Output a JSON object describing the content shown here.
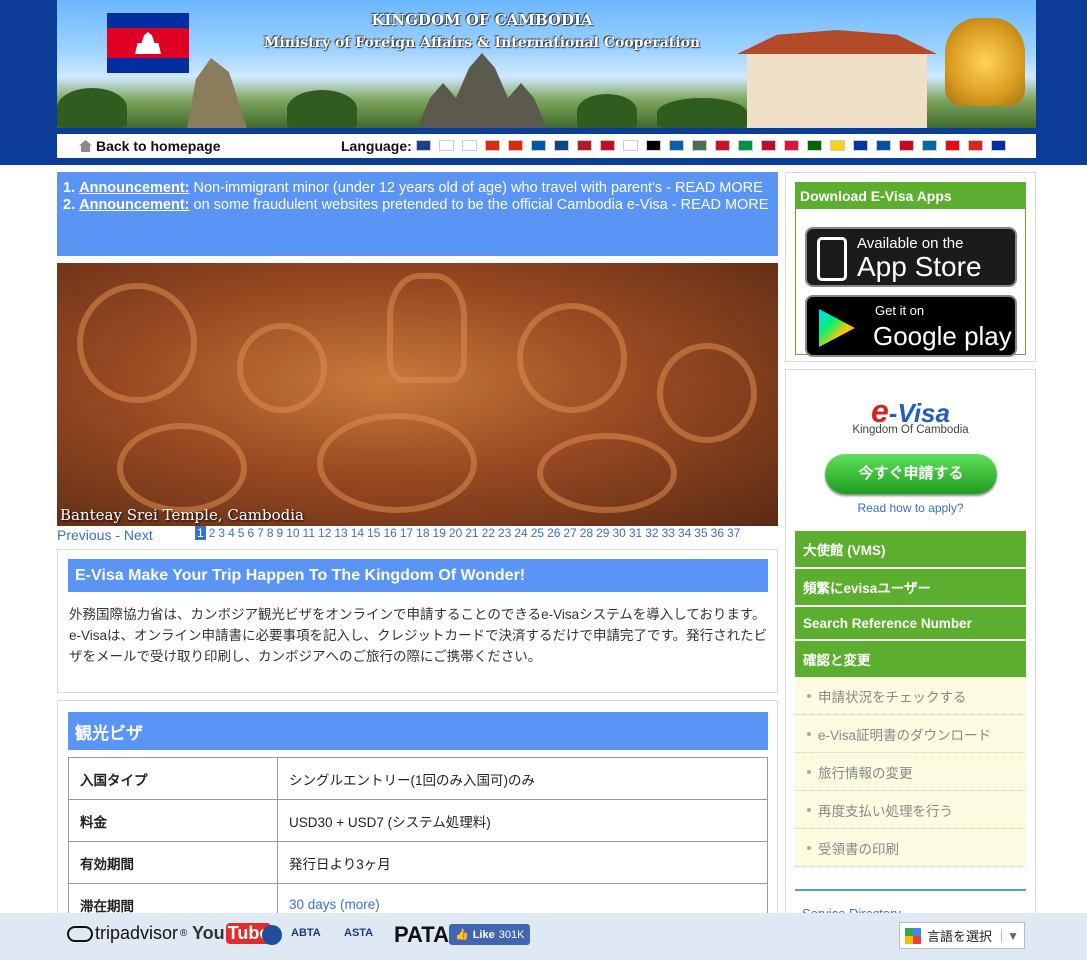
{
  "header": {
    "title_line1": "KINGDOM OF CAMBODIA",
    "title_line2": "Ministry of Foreign Affairs & International Cooperation"
  },
  "nav": {
    "home_label": "Back to homepage",
    "language_label": "Language:",
    "flag_colors": [
      "#1f3f8f",
      "#ffffff",
      "#ffffff",
      "#de2910",
      "#de2910",
      "#0055a4",
      "#11457e",
      "#ae1c28",
      "#c60b1e",
      "#ffffff",
      "#000000",
      "#0d5eaf",
      "#477050",
      "#ce1126",
      "#009246",
      "#ba0c2f",
      "#dc143c",
      "#006600",
      "#fcd116",
      "#0039a6",
      "#0b4ea2",
      "#c60b1e",
      "#006aa7",
      "#e30a17",
      "#da251d",
      "#032ea1"
    ]
  },
  "announcements": [
    {
      "num": "1.",
      "label": "Announcement:",
      "text": "Non-immigrant minor (under 12 years old of age) who travel with parent's - READ MORE"
    },
    {
      "num": "2.",
      "label": "Announcement:",
      "text": "on some fraudulent websites pretended to be the official Cambodia e-Visa - READ MORE"
    }
  ],
  "slideshow": {
    "caption": "Banteay Srei Temple, Cambodia",
    "prev": "Previous",
    "separator": " - ",
    "next": "Next",
    "current_page": "1",
    "pages": [
      "2",
      "3",
      "4",
      "5",
      "6",
      "7",
      "8",
      "9",
      "10",
      "11",
      "12",
      "13",
      "14",
      "15",
      "16",
      "17",
      "18",
      "19",
      "20",
      "21",
      "22",
      "23",
      "24",
      "25",
      "26",
      "27",
      "28",
      "29",
      "30",
      "31",
      "32",
      "33",
      "34",
      "35",
      "36",
      "37"
    ]
  },
  "intro": {
    "heading": "E-Visa Make Your Trip Happen To The Kingdom Of Wonder!",
    "body": "外務国際協力省は、カンボジア観光ビザをオンラインで申請することのできるe-Visaシステムを導入しております。e-Visaは、オンライン申請書に必要事項を記入し、クレジットカードで決済するだけで申請完了です。発行されたビザをメールで受け取り印刷し、カンボジアへのご旅行の際にご携帯ください。"
  },
  "tourist_visa": {
    "heading": "観光ビザ",
    "rows": [
      {
        "key": "入国タイプ",
        "value": "シングルエントリー(1回のみ入国可)のみ"
      },
      {
        "key": "料金",
        "value": "USD30 + USD7 (システム処理料)"
      },
      {
        "key": "有効期間",
        "value": "発行日より3ヶ月"
      },
      {
        "key": "滞在期間",
        "value": "30 days (more)"
      }
    ]
  },
  "apps": {
    "title": "Download E-Visa Apps",
    "apple_line1": "Available on the",
    "apple_line2": "App Store",
    "google_line1": "Get it on",
    "google_line2": "Google play"
  },
  "evisa": {
    "logo_e": "e",
    "logo_rest": "-Visa",
    "subtitle": "Kingdom Of Cambodia",
    "apply_button": "今すぐ申請する",
    "how_to": "Read how to apply?"
  },
  "side_menu": {
    "item1": "大使館 (VMS)",
    "item2": "頻繁にevisaユーザー",
    "item3": "Search Reference Number",
    "item4": "確認と変更",
    "subitems": [
      "申請状況をチェックする",
      "e-Visa証明書のダウンロード",
      "旅行情報の変更",
      "再度支払い処理を行う",
      "受領書の印刷"
    ],
    "service_directory": "Service Directory"
  },
  "footer": {
    "tripadvisor": "tripadvisor",
    "youtube_you": "You",
    "youtube_tube": "Tube",
    "abta": "ABTA",
    "asta": "ASTA",
    "pata": "PATA",
    "fb_like": "Like",
    "fb_count": "301K",
    "lang_select": "言語を選択"
  }
}
